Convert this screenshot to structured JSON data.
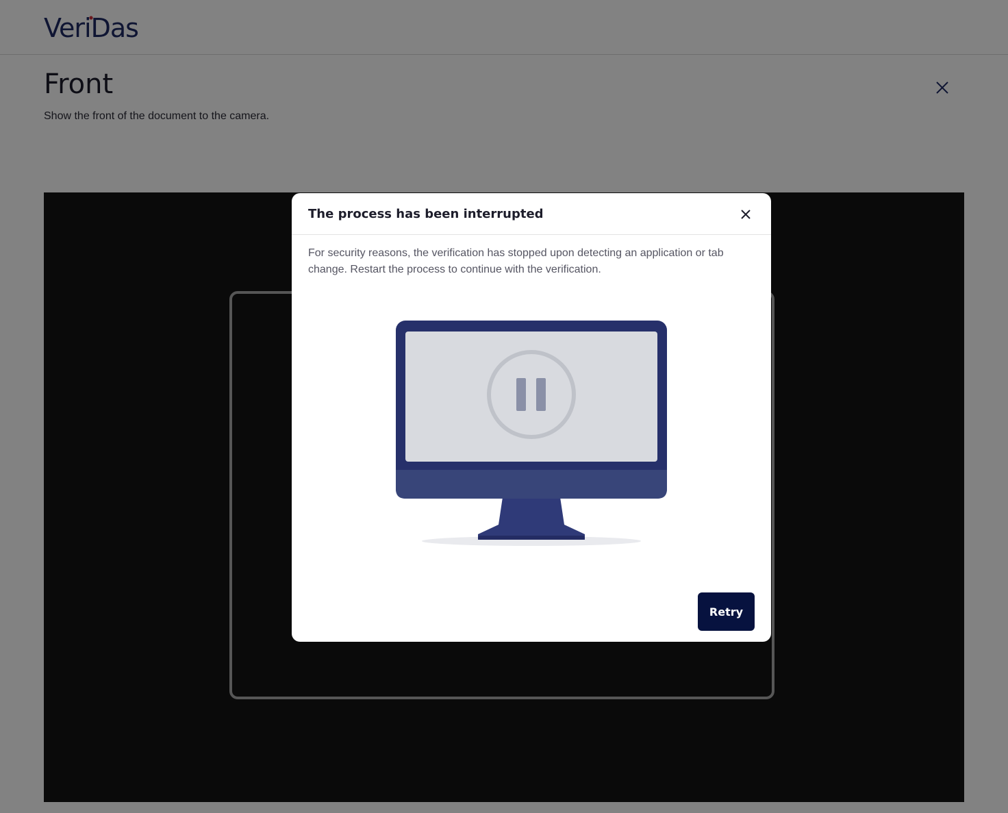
{
  "brand": {
    "logo_text_pre": "Veri",
    "logo_text_post": "as",
    "logo_letter": "D",
    "color_primary": "#1f2a64",
    "color_accent": "#d1313d"
  },
  "page": {
    "title": "Front",
    "subtitle": "Show the front of the document to the camera.",
    "close_icon": "close-icon"
  },
  "modal": {
    "title": "The process has been interrupted",
    "body": "For security reasons, the verification has stopped upon detecting an application or tab change. Restart the process to continue with the verification.",
    "retry_label": "Retry",
    "illustration_icon": "monitor-pause-icon",
    "close_icon": "close-icon"
  },
  "colors": {
    "button_bg": "#07123f",
    "monitor_frame": "#2a3167",
    "screen": "#d8dadf"
  }
}
